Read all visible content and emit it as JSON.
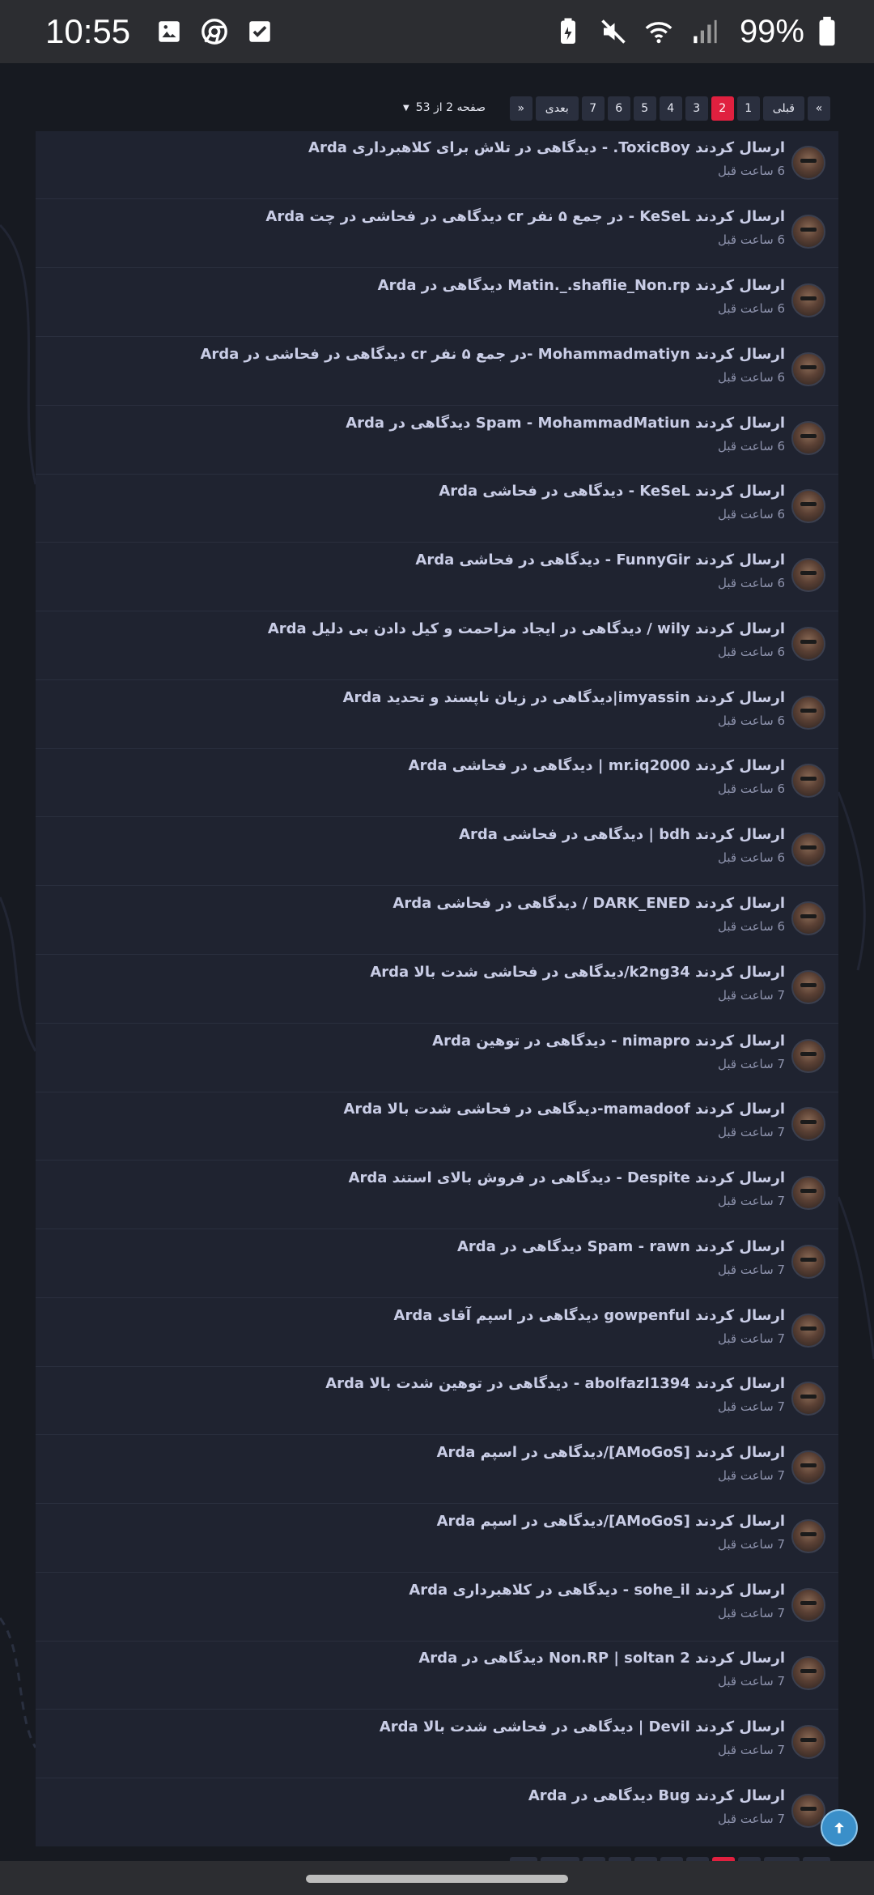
{
  "status": {
    "time": "10:55",
    "battery": "99%"
  },
  "pagination": {
    "first_label": "«",
    "prev_label": "قبلی",
    "pages": [
      "1",
      "2",
      "3",
      "4",
      "5",
      "6",
      "7"
    ],
    "active_page": "2",
    "next_label": "بعدی",
    "last_label": "»",
    "page_info": "صفحه 2 از 53"
  },
  "items": [
    {
      "title": "Arda دیدگاهی در تلاش برای کلاهبرداری - .ToxicBoy ارسال کردند",
      "time": "6 ساعت قبل"
    },
    {
      "title": "Arda دیدگاهی در فحاشی در چت cr در جمع ۵ نفر - KeSeL ارسال کردند",
      "time": "6 ساعت قبل"
    },
    {
      "title": "Arda دیدگاهی در Matin._.shaflie_Non.rp ارسال کردند",
      "time": "6 ساعت قبل"
    },
    {
      "title": "Arda دیدگاهی در فحاشی در cr در جمع ۵ نفر- Mohammadmatiyn ارسال کردند",
      "time": "6 ساعت قبل"
    },
    {
      "title": "Arda دیدگاهی در Spam - MohammadMatiun ارسال کردند",
      "time": "6 ساعت قبل"
    },
    {
      "title": "Arda دیدگاهی در فحاشی - KeSeL ارسال کردند",
      "time": "6 ساعت قبل"
    },
    {
      "title": "Arda دیدگاهی در فحاشی - FunnyGir ارسال کردند",
      "time": "6 ساعت قبل"
    },
    {
      "title": "Arda دیدگاهی در ایجاد مزاحمت و کیل دادن بی دلیل / wily ارسال کردند",
      "time": "6 ساعت قبل"
    },
    {
      "title": "Arda دیدگاهی در زبان ناپسند و تحدید|imyassin ارسال کردند",
      "time": "6 ساعت قبل"
    },
    {
      "title": "Arda دیدگاهی در فحاشی | mr.iq2000 ارسال کردند",
      "time": "6 ساعت قبل"
    },
    {
      "title": "Arda دیدگاهی در فحاشی | bdh ارسال کردند",
      "time": "6 ساعت قبل"
    },
    {
      "title": "Arda دیدگاهی در فحاشی / DARK_ENED ارسال کردند",
      "time": "6 ساعت قبل"
    },
    {
      "title": "Arda دیدگاهی در فحاشی شدت بالا/k2ng34 ارسال کردند",
      "time": "7 ساعت قبل"
    },
    {
      "title": "Arda دیدگاهی در توهین - nimapro ارسال کردند",
      "time": "7 ساعت قبل"
    },
    {
      "title": "Arda دیدگاهی در فحاشی شدت بالا-mamadoof ارسال کردند",
      "time": "7 ساعت قبل"
    },
    {
      "title": "Arda دیدگاهی در فروش بالای استند - Despite ارسال کردند",
      "time": "7 ساعت قبل"
    },
    {
      "title": "Arda دیدگاهی در Spam - rawn ارسال کردند",
      "time": "7 ساعت قبل"
    },
    {
      "title": "Arda دیدگاهی در اسپم آقای gowpenful ارسال کردند",
      "time": "7 ساعت قبل"
    },
    {
      "title": "Arda دیدگاهی در توهین شدت بالا - abolfazl1394 ارسال کردند",
      "time": "7 ساعت قبل"
    },
    {
      "title": "Arda دیدگاهی در اسپم/[AMoGoS] ارسال کردند",
      "time": "7 ساعت قبل"
    },
    {
      "title": "Arda دیدگاهی در اسپم/[AMoGoS] ارسال کردند",
      "time": "7 ساعت قبل"
    },
    {
      "title": "Arda دیدگاهی در کلاهبرداری - sohe_il ارسال کردند",
      "time": "7 ساعت قبل"
    },
    {
      "title": "Arda دیدگاهی در Non.RP | soltan 2 ارسال کردند",
      "time": "7 ساعت قبل"
    },
    {
      "title": "Arda دیدگاهی در فحاشی شدت بالا | Devil ارسال کردند",
      "time": "7 ساعت قبل"
    },
    {
      "title": "Arda دیدگاهی در Bug ارسال کردند",
      "time": "7 ساعت قبل"
    }
  ],
  "icons": {
    "scroll_top": "arrow-up-icon"
  }
}
